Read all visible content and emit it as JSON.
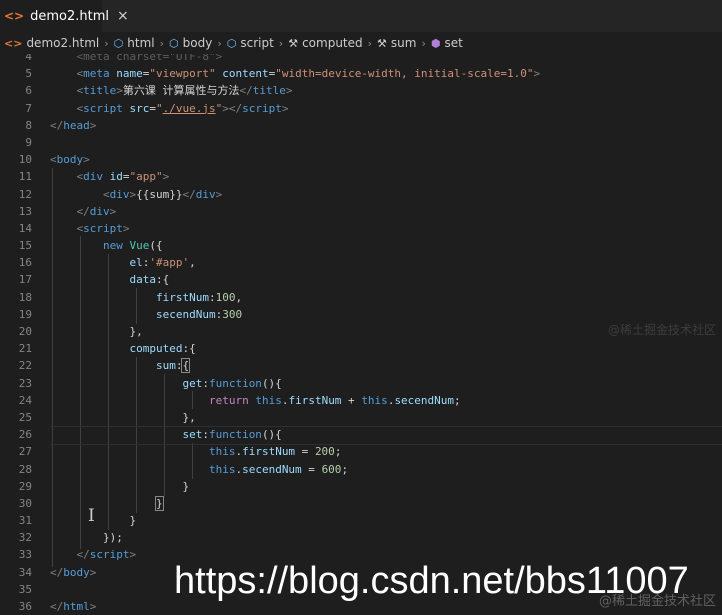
{
  "tab": {
    "filename": "demo2.html",
    "icon": "html-file-icon",
    "close_glyph": "×"
  },
  "breadcrumb": [
    {
      "label": "demo2.html",
      "icon": "html-file-icon"
    },
    {
      "label": "html",
      "icon": "cube-icon"
    },
    {
      "label": "body",
      "icon": "cube-icon"
    },
    {
      "label": "script",
      "icon": "cube-icon"
    },
    {
      "label": "computed",
      "icon": "wrench-icon"
    },
    {
      "label": "sum",
      "icon": "wrench-icon"
    },
    {
      "label": "set",
      "icon": "method-icon"
    }
  ],
  "line_numbers": [
    "4",
    "5",
    "6",
    "7",
    "8",
    "9",
    "10",
    "11",
    "12",
    "13",
    "14",
    "15",
    "16",
    "17",
    "18",
    "19",
    "20",
    "21",
    "22",
    "23",
    "24",
    "25",
    "26",
    "27",
    "28",
    "29",
    "30",
    "31",
    "32",
    "33",
    "34",
    "35",
    "36"
  ],
  "code": [
    [
      [
        "faded",
        "    <meta charset=\"UTF-8\">"
      ]
    ],
    [
      [
        "text",
        "    "
      ],
      [
        "punct",
        "<"
      ],
      [
        "tag",
        "meta"
      ],
      [
        "text",
        " "
      ],
      [
        "attr",
        "name"
      ],
      [
        "text",
        "="
      ],
      [
        "str",
        "\"viewport\""
      ],
      [
        "text",
        " "
      ],
      [
        "attr",
        "content"
      ],
      [
        "text",
        "="
      ],
      [
        "str",
        "\"width=device-width, initial-scale=1.0\""
      ],
      [
        "punct",
        ">"
      ]
    ],
    [
      [
        "text",
        "    "
      ],
      [
        "punct",
        "<"
      ],
      [
        "tag",
        "title"
      ],
      [
        "punct",
        ">"
      ],
      [
        "text",
        "第六课 计算属性与方法"
      ],
      [
        "punct",
        "</"
      ],
      [
        "tag",
        "title"
      ],
      [
        "punct",
        ">"
      ]
    ],
    [
      [
        "text",
        "    "
      ],
      [
        "punct",
        "<"
      ],
      [
        "tag",
        "script"
      ],
      [
        "text",
        " "
      ],
      [
        "attr",
        "src"
      ],
      [
        "text",
        "="
      ],
      [
        "str",
        "\""
      ],
      [
        "str underline",
        "./vue.js"
      ],
      [
        "str",
        "\""
      ],
      [
        "punct",
        "></"
      ],
      [
        "tag",
        "script"
      ],
      [
        "punct",
        ">"
      ]
    ],
    [
      [
        "punct",
        "</"
      ],
      [
        "tag",
        "head"
      ],
      [
        "punct",
        ">"
      ]
    ],
    [
      [
        "text",
        ""
      ]
    ],
    [
      [
        "punct",
        "<"
      ],
      [
        "tag",
        "body"
      ],
      [
        "punct",
        ">"
      ]
    ],
    [
      [
        "text",
        "    "
      ],
      [
        "punct",
        "<"
      ],
      [
        "tag",
        "div"
      ],
      [
        "text",
        " "
      ],
      [
        "attr",
        "id"
      ],
      [
        "text",
        "="
      ],
      [
        "str",
        "\"app\""
      ],
      [
        "punct",
        ">"
      ]
    ],
    [
      [
        "text",
        "        "
      ],
      [
        "punct",
        "<"
      ],
      [
        "tag",
        "div"
      ],
      [
        "punct",
        ">"
      ],
      [
        "text",
        "{{sum}}"
      ],
      [
        "punct",
        "</"
      ],
      [
        "tag",
        "div"
      ],
      [
        "punct",
        ">"
      ]
    ],
    [
      [
        "text",
        "    "
      ],
      [
        "punct",
        "</"
      ],
      [
        "tag",
        "div"
      ],
      [
        "punct",
        ">"
      ]
    ],
    [
      [
        "text",
        "    "
      ],
      [
        "punct",
        "<"
      ],
      [
        "tag",
        "script"
      ],
      [
        "punct",
        ">"
      ]
    ],
    [
      [
        "text",
        "        "
      ],
      [
        "kw",
        "new"
      ],
      [
        "text",
        " "
      ],
      [
        "cls",
        "Vue"
      ],
      [
        "text",
        "({"
      ]
    ],
    [
      [
        "text",
        "            "
      ],
      [
        "prop",
        "el"
      ],
      [
        "text",
        ":"
      ],
      [
        "str",
        "'#app'"
      ],
      [
        "text",
        ","
      ]
    ],
    [
      [
        "text",
        "            "
      ],
      [
        "prop",
        "data"
      ],
      [
        "text",
        ":{"
      ]
    ],
    [
      [
        "text",
        "                "
      ],
      [
        "prop",
        "firstNum"
      ],
      [
        "text",
        ":"
      ],
      [
        "num",
        "100"
      ],
      [
        "text",
        ","
      ]
    ],
    [
      [
        "text",
        "                "
      ],
      [
        "prop",
        "secendNum"
      ],
      [
        "text",
        ":"
      ],
      [
        "num",
        "300"
      ]
    ],
    [
      [
        "text",
        "            },"
      ]
    ],
    [
      [
        "text",
        "            "
      ],
      [
        "prop",
        "computed"
      ],
      [
        "text",
        ":{"
      ]
    ],
    [
      [
        "text",
        "                "
      ],
      [
        "prop",
        "sum"
      ],
      [
        "text",
        ":"
      ],
      [
        "text boxed",
        "{"
      ]
    ],
    [
      [
        "text",
        "                    "
      ],
      [
        "prop",
        "get"
      ],
      [
        "text",
        ":"
      ],
      [
        "kw",
        "function"
      ],
      [
        "text",
        "(){"
      ]
    ],
    [
      [
        "text",
        "                        "
      ],
      [
        "ctl",
        "return"
      ],
      [
        "text",
        " "
      ],
      [
        "kw",
        "this"
      ],
      [
        "text",
        "."
      ],
      [
        "prop",
        "firstNum"
      ],
      [
        "text",
        " + "
      ],
      [
        "kw",
        "this"
      ],
      [
        "text",
        "."
      ],
      [
        "prop",
        "secendNum"
      ],
      [
        "text",
        ";"
      ]
    ],
    [
      [
        "text",
        "                    },"
      ]
    ],
    [
      [
        "text",
        "                    "
      ],
      [
        "prop",
        "set"
      ],
      [
        "text",
        ":"
      ],
      [
        "kw",
        "function"
      ],
      [
        "text",
        "(){"
      ]
    ],
    [
      [
        "text",
        "                        "
      ],
      [
        "kw",
        "this"
      ],
      [
        "text",
        "."
      ],
      [
        "prop",
        "firstNum"
      ],
      [
        "text",
        " = "
      ],
      [
        "num",
        "200"
      ],
      [
        "text",
        ";"
      ]
    ],
    [
      [
        "text",
        "                        "
      ],
      [
        "kw",
        "this"
      ],
      [
        "text",
        "."
      ],
      [
        "prop",
        "secendNum"
      ],
      [
        "text",
        " = "
      ],
      [
        "num",
        "600"
      ],
      [
        "text",
        ";"
      ]
    ],
    [
      [
        "text",
        "                    }"
      ]
    ],
    [
      [
        "text",
        "                "
      ],
      [
        "text boxed",
        "}"
      ]
    ],
    [
      [
        "text",
        "            }"
      ]
    ],
    [
      [
        "text",
        "        });"
      ]
    ],
    [
      [
        "text",
        "    "
      ],
      [
        "punct",
        "</"
      ],
      [
        "tag",
        "script"
      ],
      [
        "punct",
        ">"
      ]
    ],
    [
      [
        "punct",
        "</"
      ],
      [
        "tag",
        "body"
      ],
      [
        "punct",
        ">"
      ]
    ],
    [
      [
        "text",
        ""
      ]
    ],
    [
      [
        "punct",
        "</"
      ],
      [
        "tag",
        "html"
      ],
      [
        "punct",
        ">"
      ]
    ]
  ],
  "watermark": {
    "url": "https://blog.csdn.net/bbs11007",
    "small": "@稀土掘金技术社区"
  }
}
